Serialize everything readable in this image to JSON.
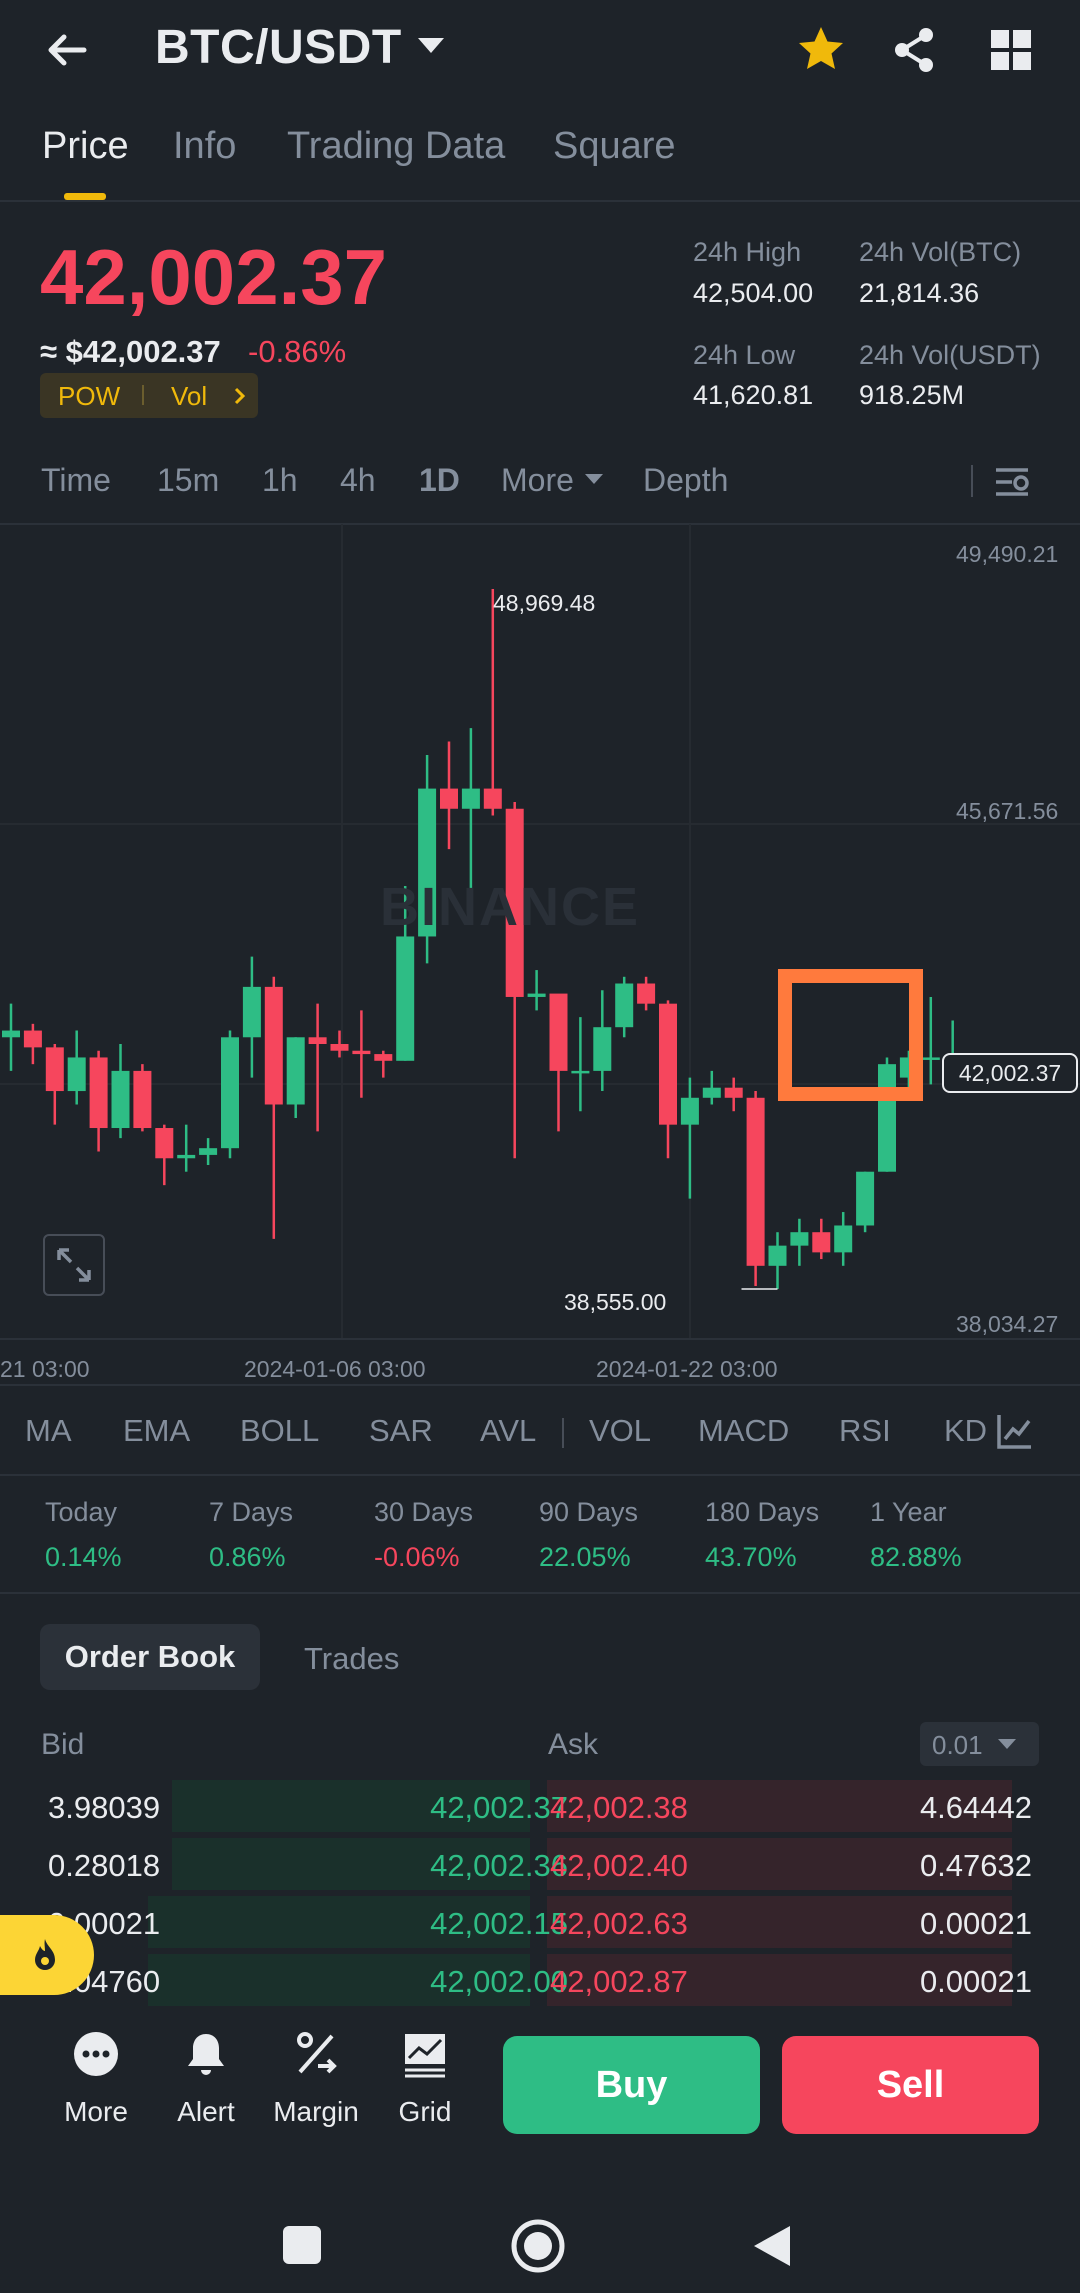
{
  "header": {
    "pair": "BTC/USDT",
    "icons": [
      "back-arrow-icon",
      "dropdown-caret-icon",
      "star-icon",
      "share-icon",
      "grid-menu-icon"
    ],
    "star_color": "#f0b90b"
  },
  "tabs": [
    {
      "label": "Price",
      "active": true
    },
    {
      "label": "Info"
    },
    {
      "label": "Trading Data"
    },
    {
      "label": "Square"
    }
  ],
  "price": {
    "last": "42,002.37",
    "usd": "≈ $42,002.37",
    "change_pct": "-0.86%",
    "tag_pow": "POW",
    "tag_vol": "Vol"
  },
  "stats": {
    "high_label": "24h High",
    "high_value": "42,504.00",
    "low_label": "24h Low",
    "low_value": "41,620.81",
    "volbtc_label": "24h Vol(BTC)",
    "volbtc_value": "21,814.36",
    "volusdt_label": "24h Vol(USDT)",
    "volusdt_value": "918.25M"
  },
  "intervals": {
    "time": "Time",
    "m15": "15m",
    "h1": "1h",
    "h4": "4h",
    "d1": "1D",
    "more": "More",
    "depth": "Depth",
    "active": "1D"
  },
  "chart": {
    "axis_top": "49,490.21",
    "axis_mid": "45,671.56",
    "axis_bottom": "38,034.27",
    "last_price_tag": "42,002.37",
    "max_label": "48,969.48",
    "min_label": "38,555.00",
    "watermark": "BINANCE",
    "dates": [
      "21 03:00",
      "2024-01-06 03:00",
      "2024-01-22 03:00"
    ]
  },
  "chart_data": {
    "type": "candlestick",
    "y_range": [
      38034.27,
      49490.21
    ],
    "y_ticks": [
      49490.21,
      45671.56,
      38034.27
    ],
    "x_tick_labels": [
      "21 03:00",
      "2024-01-06 03:00",
      "2024-01-22 03:00"
    ],
    "last_price": 42002.37,
    "annotations": {
      "high": 48969.48,
      "low": 38555.0
    },
    "candles": [
      {
        "o": 42300,
        "h": 42800,
        "l": 41800,
        "c": 42400
      },
      {
        "o": 42400,
        "h": 42500,
        "l": 41900,
        "c": 42150
      },
      {
        "o": 42150,
        "h": 42200,
        "l": 41000,
        "c": 41500
      },
      {
        "o": 41500,
        "h": 42400,
        "l": 41300,
        "c": 42000
      },
      {
        "o": 42000,
        "h": 42100,
        "l": 40600,
        "c": 40950
      },
      {
        "o": 40950,
        "h": 42200,
        "l": 40800,
        "c": 41800
      },
      {
        "o": 41800,
        "h": 41900,
        "l": 40900,
        "c": 40950
      },
      {
        "o": 40950,
        "h": 41000,
        "l": 40100,
        "c": 40500
      },
      {
        "o": 40500,
        "h": 41000,
        "l": 40300,
        "c": 40550
      },
      {
        "o": 40550,
        "h": 40800,
        "l": 40400,
        "c": 40650
      },
      {
        "o": 40650,
        "h": 42400,
        "l": 40500,
        "c": 42300
      },
      {
        "o": 42300,
        "h": 43500,
        "l": 41700,
        "c": 43050
      },
      {
        "o": 43050,
        "h": 43200,
        "l": 39300,
        "c": 41300
      },
      {
        "o": 41300,
        "h": 42300,
        "l": 41100,
        "c": 42300
      },
      {
        "o": 42300,
        "h": 42800,
        "l": 40900,
        "c": 42200
      },
      {
        "o": 42200,
        "h": 42400,
        "l": 42000,
        "c": 42100
      },
      {
        "o": 42100,
        "h": 42700,
        "l": 41400,
        "c": 42050
      },
      {
        "o": 42050,
        "h": 42100,
        "l": 41700,
        "c": 41950
      },
      {
        "o": 41950,
        "h": 44550,
        "l": 41950,
        "c": 43800
      },
      {
        "o": 43800,
        "h": 46500,
        "l": 43400,
        "c": 46000
      },
      {
        "o": 46000,
        "h": 46700,
        "l": 45100,
        "c": 45700
      },
      {
        "o": 45700,
        "h": 46900,
        "l": 44100,
        "c": 46000
      },
      {
        "o": 46000,
        "h": 48970,
        "l": 45600,
        "c": 45700
      },
      {
        "o": 45700,
        "h": 45800,
        "l": 40500,
        "c": 42900
      },
      {
        "o": 42900,
        "h": 43300,
        "l": 42700,
        "c": 42950
      },
      {
        "o": 42950,
        "h": 42900,
        "l": 40900,
        "c": 41800
      },
      {
        "o": 41800,
        "h": 42600,
        "l": 41200,
        "c": 41800
      },
      {
        "o": 41800,
        "h": 43000,
        "l": 41500,
        "c": 42450
      },
      {
        "o": 42450,
        "h": 43200,
        "l": 42300,
        "c": 43100
      },
      {
        "o": 43100,
        "h": 43200,
        "l": 42700,
        "c": 42800
      },
      {
        "o": 42800,
        "h": 42850,
        "l": 40500,
        "c": 41000
      },
      {
        "o": 41000,
        "h": 41700,
        "l": 39900,
        "c": 41400
      },
      {
        "o": 41400,
        "h": 41800,
        "l": 41300,
        "c": 41550
      },
      {
        "o": 41550,
        "h": 41700,
        "l": 41200,
        "c": 41400
      },
      {
        "o": 41400,
        "h": 41500,
        "l": 38600,
        "c": 38900
      },
      {
        "o": 38900,
        "h": 39400,
        "l": 38555,
        "c": 39200
      },
      {
        "o": 39200,
        "h": 39600,
        "l": 38900,
        "c": 39400
      },
      {
        "o": 39400,
        "h": 39600,
        "l": 39000,
        "c": 39100
      },
      {
        "o": 39100,
        "h": 39700,
        "l": 38900,
        "c": 39500
      },
      {
        "o": 39500,
        "h": 40300,
        "l": 39400,
        "c": 40300
      },
      {
        "o": 40300,
        "h": 42000,
        "l": 40300,
        "c": 41900
      },
      {
        "o": 41700,
        "h": 42100,
        "l": 41500,
        "c": 42000
      },
      {
        "o": 42000,
        "h": 42900,
        "l": 41600,
        "c": 42000
      },
      {
        "o": 42000,
        "h": 42550,
        "l": 41600,
        "c": 42002.37
      }
    ]
  },
  "highlight_box_color": "#ff7a3d",
  "indicators": [
    "MA",
    "EMA",
    "BOLL",
    "SAR",
    "AVL",
    "VOL",
    "MACD",
    "RSI",
    "KD"
  ],
  "performance": [
    {
      "label": "Today",
      "value": "0.14%",
      "dir": "up"
    },
    {
      "label": "7 Days",
      "value": "0.86%",
      "dir": "up"
    },
    {
      "label": "30 Days",
      "value": "-0.06%",
      "dir": "down"
    },
    {
      "label": "90 Days",
      "value": "22.05%",
      "dir": "up"
    },
    {
      "label": "180 Days",
      "value": "43.70%",
      "dir": "up"
    },
    {
      "label": "1 Year",
      "value": "82.88%",
      "dir": "up"
    }
  ],
  "orderbook": {
    "tab_active": "Order Book",
    "tab_other": "Trades",
    "bid_label": "Bid",
    "ask_label": "Ask",
    "precision": "0.01",
    "rows": [
      {
        "bid_qty": "3.98039",
        "bid_price": "42,002.37",
        "ask_price": "42,002.38",
        "ask_qty": "4.64442",
        "bid_depth": 0.73,
        "ask_depth": 1.0
      },
      {
        "bid_qty": "0.28018",
        "bid_price": "42,002.36",
        "ask_price": "42,002.40",
        "ask_qty": "0.47632",
        "bid_depth": 0.73,
        "ask_depth": 1.0
      },
      {
        "bid_qty": "0.00021",
        "bid_price": "42,002.15",
        "ask_price": "42,002.63",
        "ask_qty": "0.00021",
        "bid_depth": 0.78,
        "ask_depth": 1.0
      },
      {
        "bid_qty": "0.04760",
        "bid_price": "42,002.00",
        "ask_price": "42,002.87",
        "ask_qty": "0.00021",
        "bid_depth": 0.78,
        "ask_depth": 1.0
      }
    ]
  },
  "bottom": {
    "more": "More",
    "alert": "Alert",
    "margin": "Margin",
    "grid": "Grid",
    "buy": "Buy",
    "sell": "Sell",
    "buy_color": "#2ebd85",
    "sell_color": "#f6465d"
  },
  "colors": {
    "up": "#2ebd85",
    "down": "#f6465d",
    "bg": "#1e2329",
    "accent": "#f0b90b"
  }
}
